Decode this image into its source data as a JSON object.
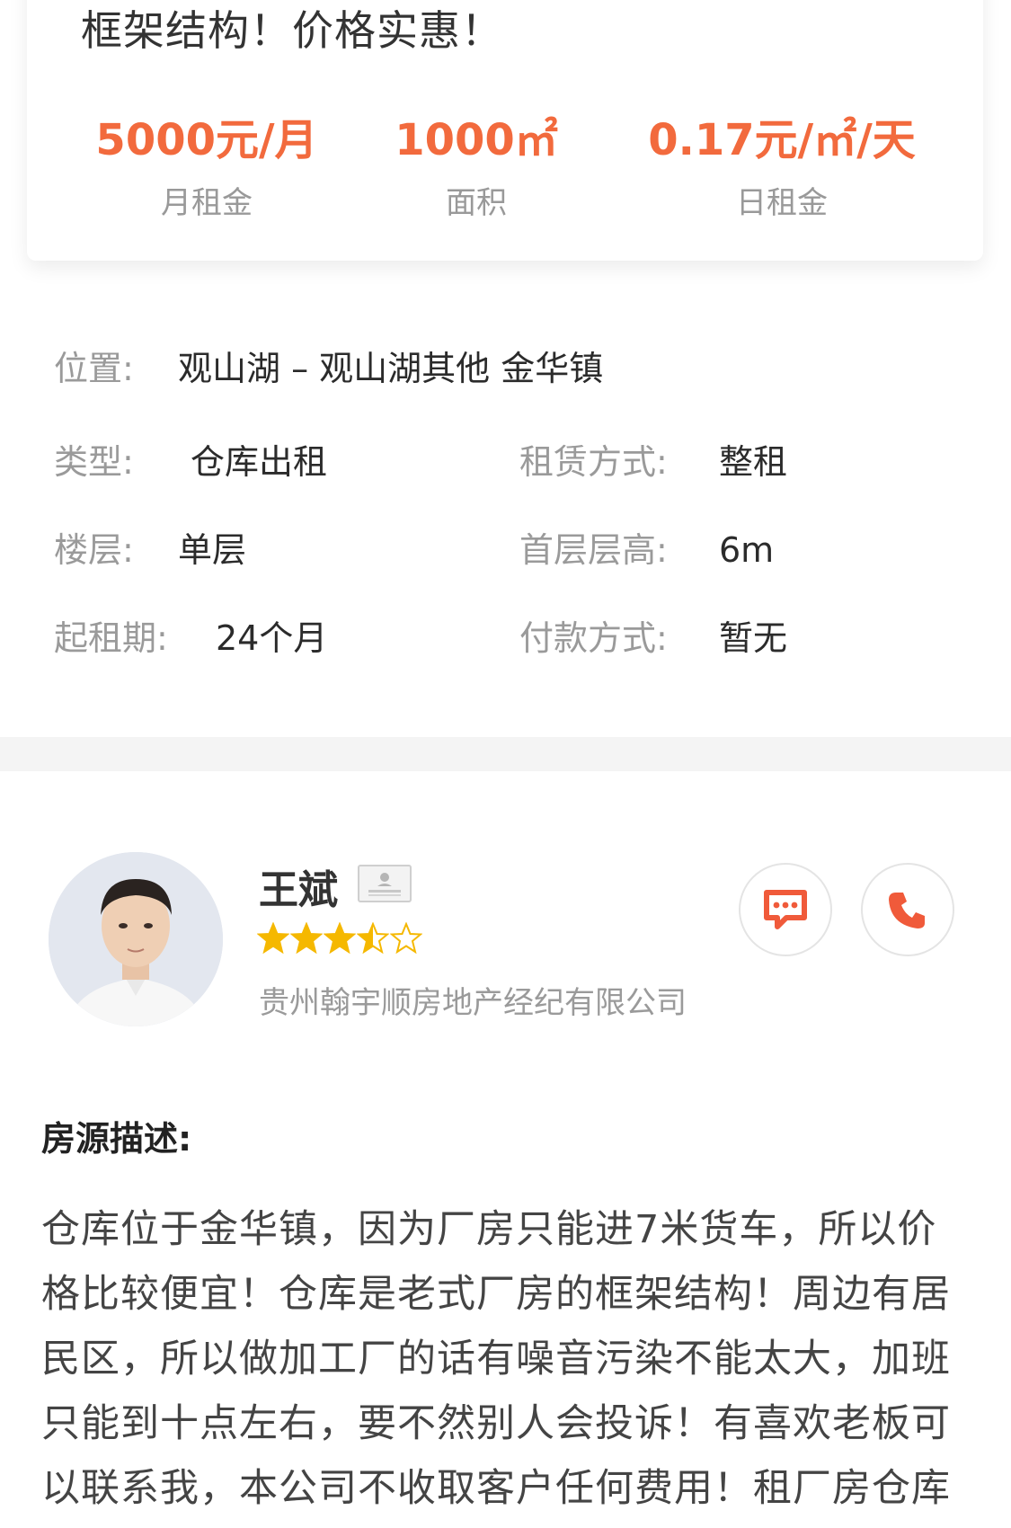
{
  "card": {
    "title": "框架结构！价格实惠！",
    "stats": [
      {
        "value": "5000元/月",
        "label": "月租金"
      },
      {
        "value": "1000㎡",
        "label": "面积"
      },
      {
        "value": "0.17元/㎡/天",
        "label": "日租金"
      }
    ]
  },
  "info": {
    "location_label": "位置:",
    "location_value": "观山湖 – 观山湖其他 金华镇",
    "type_label": "类型:",
    "type_value": "仓库出租",
    "lease_label": "租赁方式:",
    "lease_value": "整租",
    "floor_label": "楼层:",
    "floor_value": "单层",
    "height_label": "首层层高:",
    "height_value": "6m",
    "term_label": "起租期:",
    "term_value": "24个月",
    "payment_label": "付款方式:",
    "payment_value": "暂无"
  },
  "agent": {
    "name": "王斌",
    "rating": 3.5,
    "rating_max": 5,
    "company": "贵州翰宇顺房地产经纪有限公司",
    "chat_icon": "chat-icon",
    "phone_icon": "phone-icon"
  },
  "description": {
    "title": "房源描述:",
    "lines": [
      "仓库位于金华镇，因为厂房只能进7米货车，所以价",
      "格比较便宜！仓库是老式厂房的框架结构！周边有居",
      "民区，所以做加工厂的话有噪音污染不能太大，加班",
      "只能到十点左右，要不然别人会投诉！有喜欢老板可",
      "以联系我，本公司不收取客户任何费用！租厂房仓库"
    ]
  },
  "colors": {
    "accent": "#f26a3d",
    "star": "#f5b800",
    "label_gray": "#9a9a9a"
  }
}
